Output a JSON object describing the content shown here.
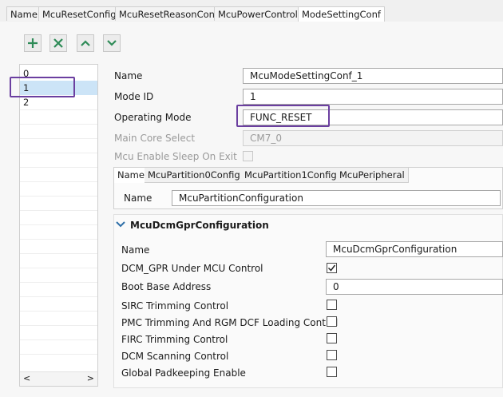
{
  "top_tabs": [
    "Name",
    "McuResetConfig",
    "McuResetReasonConf",
    "McuPowerControl",
    "ModeSettingConf"
  ],
  "toolbar": {
    "add_icon": "plus-icon",
    "remove_icon": "x-icon",
    "up_icon": "chevron-up-icon",
    "down_icon": "chevron-down-icon"
  },
  "list": {
    "items": [
      "0",
      "1",
      "2"
    ],
    "selected_index": 1,
    "scroll_left": "<",
    "scroll_right": ">"
  },
  "form": {
    "name_label": "Name",
    "name_value": "McuModeSettingConf_1",
    "mode_id_label": "Mode ID",
    "mode_id_value": "1",
    "operating_mode_label": "Operating Mode",
    "operating_mode_value": "FUNC_RESET",
    "main_core_label": "Main Core Select",
    "main_core_value": "CM7_0",
    "sleep_label": "Mcu Enable Sleep On Exit"
  },
  "inner_tabs": [
    "Name",
    "McuPartition0Config",
    "McuPartition1Config",
    "McuPeripheral"
  ],
  "partition": {
    "name_label": "Name",
    "name_value": "McuPartitionConfiguration"
  },
  "dcm": {
    "title": "McuDcmGprConfiguration",
    "name_label": "Name",
    "name_value": "McuDcmGprConfiguration",
    "dcm_gpr_label": "DCM_GPR Under MCU Control",
    "dcm_gpr_checked": true,
    "boot_base_label": "Boot Base Address",
    "boot_base_value": "0",
    "sirc_label": "SIRC Trimming Control",
    "pmc_label": "PMC Trimming And RGM DCF Loading Control",
    "firc_label": "FIRC Trimming Control",
    "dcm_scan_label": "DCM Scanning Control",
    "padkeep_label": "Global Padkeeping Enable"
  },
  "colors": {
    "accent": "#2e8b57",
    "highlight": "#6b3fa0",
    "selection": "#cce4f7"
  }
}
